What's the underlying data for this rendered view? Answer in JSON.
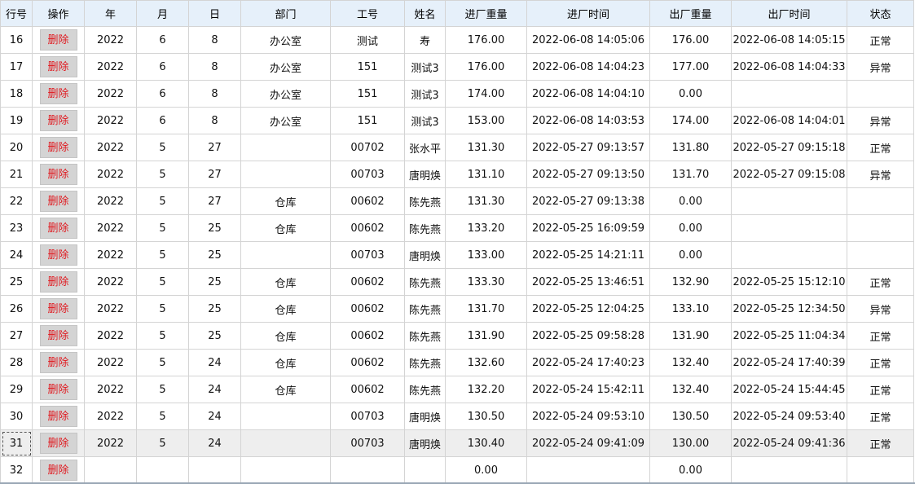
{
  "columns": [
    "行号",
    "操作",
    "年",
    "月",
    "日",
    "部门",
    "工号",
    "姓名",
    "进厂重量",
    "进厂时间",
    "出厂重量",
    "出厂时间",
    "状态"
  ],
  "delete_label": "删除",
  "colors": {
    "normal": "#1a3ccf",
    "abnormal": "#e0191f",
    "header_bg": "#e6f0fa",
    "button_bg": "#d4d4d4"
  },
  "rows": [
    {
      "no": "16",
      "year": "2022",
      "month": "6",
      "day": "8",
      "dept": "办公室",
      "emp_id": "测试",
      "name": "寿",
      "in_weight": "176.00",
      "in_time": "2022-06-08 14:05:06",
      "out_weight": "176.00",
      "out_time": "2022-06-08 14:05:15",
      "status": "正常"
    },
    {
      "no": "17",
      "year": "2022",
      "month": "6",
      "day": "8",
      "dept": "办公室",
      "emp_id": "151",
      "name": "测试3",
      "in_weight": "176.00",
      "in_time": "2022-06-08 14:04:23",
      "out_weight": "177.00",
      "out_time": "2022-06-08 14:04:33",
      "status": "异常"
    },
    {
      "no": "18",
      "year": "2022",
      "month": "6",
      "day": "8",
      "dept": "办公室",
      "emp_id": "151",
      "name": "测试3",
      "in_weight": "174.00",
      "in_time": "2022-06-08 14:04:10",
      "out_weight": "0.00",
      "out_time": "",
      "status": ""
    },
    {
      "no": "19",
      "year": "2022",
      "month": "6",
      "day": "8",
      "dept": "办公室",
      "emp_id": "151",
      "name": "测试3",
      "in_weight": "153.00",
      "in_time": "2022-06-08 14:03:53",
      "out_weight": "174.00",
      "out_time": "2022-06-08 14:04:01",
      "status": "异常"
    },
    {
      "no": "20",
      "year": "2022",
      "month": "5",
      "day": "27",
      "dept": "",
      "emp_id": "00702",
      "name": "张水平",
      "in_weight": "131.30",
      "in_time": "2022-05-27 09:13:57",
      "out_weight": "131.80",
      "out_time": "2022-05-27 09:15:18",
      "status": "正常"
    },
    {
      "no": "21",
      "year": "2022",
      "month": "5",
      "day": "27",
      "dept": "",
      "emp_id": "00703",
      "name": "唐明焕",
      "in_weight": "131.10",
      "in_time": "2022-05-27 09:13:50",
      "out_weight": "131.70",
      "out_time": "2022-05-27 09:15:08",
      "status": "异常"
    },
    {
      "no": "22",
      "year": "2022",
      "month": "5",
      "day": "27",
      "dept": "仓库",
      "emp_id": "00602",
      "name": "陈先燕",
      "in_weight": "131.30",
      "in_time": "2022-05-27 09:13:38",
      "out_weight": "0.00",
      "out_time": "",
      "status": ""
    },
    {
      "no": "23",
      "year": "2022",
      "month": "5",
      "day": "25",
      "dept": "仓库",
      "emp_id": "00602",
      "name": "陈先燕",
      "in_weight": "133.20",
      "in_time": "2022-05-25 16:09:59",
      "out_weight": "0.00",
      "out_time": "",
      "status": ""
    },
    {
      "no": "24",
      "year": "2022",
      "month": "5",
      "day": "25",
      "dept": "",
      "emp_id": "00703",
      "name": "唐明焕",
      "in_weight": "133.00",
      "in_time": "2022-05-25 14:21:11",
      "out_weight": "0.00",
      "out_time": "",
      "status": ""
    },
    {
      "no": "25",
      "year": "2022",
      "month": "5",
      "day": "25",
      "dept": "仓库",
      "emp_id": "00602",
      "name": "陈先燕",
      "in_weight": "133.30",
      "in_time": "2022-05-25 13:46:51",
      "out_weight": "132.90",
      "out_time": "2022-05-25 15:12:10",
      "status": "正常"
    },
    {
      "no": "26",
      "year": "2022",
      "month": "5",
      "day": "25",
      "dept": "仓库",
      "emp_id": "00602",
      "name": "陈先燕",
      "in_weight": "131.70",
      "in_time": "2022-05-25 12:04:25",
      "out_weight": "133.10",
      "out_time": "2022-05-25 12:34:50",
      "status": "异常"
    },
    {
      "no": "27",
      "year": "2022",
      "month": "5",
      "day": "25",
      "dept": "仓库",
      "emp_id": "00602",
      "name": "陈先燕",
      "in_weight": "131.90",
      "in_time": "2022-05-25 09:58:28",
      "out_weight": "131.90",
      "out_time": "2022-05-25 11:04:34",
      "status": "正常"
    },
    {
      "no": "28",
      "year": "2022",
      "month": "5",
      "day": "24",
      "dept": "仓库",
      "emp_id": "00602",
      "name": "陈先燕",
      "in_weight": "132.60",
      "in_time": "2022-05-24 17:40:23",
      "out_weight": "132.40",
      "out_time": "2022-05-24 17:40:39",
      "status": "正常"
    },
    {
      "no": "29",
      "year": "2022",
      "month": "5",
      "day": "24",
      "dept": "仓库",
      "emp_id": "00602",
      "name": "陈先燕",
      "in_weight": "132.20",
      "in_time": "2022-05-24 15:42:11",
      "out_weight": "132.40",
      "out_time": "2022-05-24 15:44:45",
      "status": "正常"
    },
    {
      "no": "30",
      "year": "2022",
      "month": "5",
      "day": "24",
      "dept": "",
      "emp_id": "00703",
      "name": "唐明焕",
      "in_weight": "130.50",
      "in_time": "2022-05-24 09:53:10",
      "out_weight": "130.50",
      "out_time": "2022-05-24 09:53:40",
      "status": "正常"
    },
    {
      "no": "31",
      "year": "2022",
      "month": "5",
      "day": "24",
      "dept": "",
      "emp_id": "00703",
      "name": "唐明焕",
      "in_weight": "130.40",
      "in_time": "2022-05-24 09:41:09",
      "out_weight": "130.00",
      "out_time": "2022-05-24 09:41:36",
      "status": "正常"
    },
    {
      "no": "32",
      "year": "",
      "month": "",
      "day": "",
      "dept": "",
      "emp_id": "",
      "name": "",
      "in_weight": "0.00",
      "in_time": "",
      "out_weight": "0.00",
      "out_time": "",
      "status": ""
    }
  ],
  "selected_row": "31"
}
